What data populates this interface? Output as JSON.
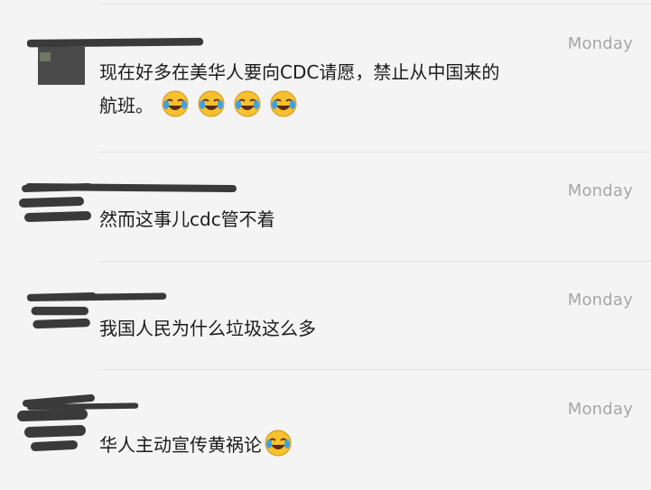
{
  "messages": [
    {
      "time": "Monday",
      "text_line1": "现在好多在美华人要向CDC请愿，禁止从中国来的",
      "text_line2": "航班。",
      "emoji_count": 4,
      "emoji": "face-with-tears-of-joy-icon"
    },
    {
      "time": "Monday",
      "text": "然而这事儿cdc管不着"
    },
    {
      "time": "Monday",
      "text": "我国人民为什么垃圾这么多"
    },
    {
      "time": "Monday",
      "text": "华人主动宣传黄祸论",
      "emoji_count": 1,
      "emoji": "face-with-tears-of-joy-icon"
    }
  ]
}
